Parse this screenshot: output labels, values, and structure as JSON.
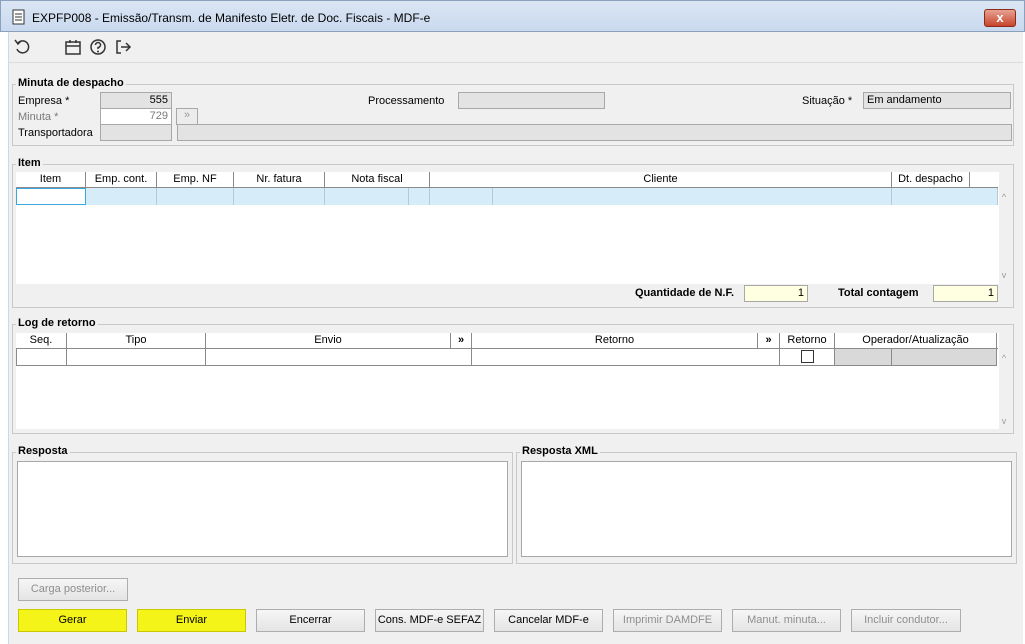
{
  "window": {
    "title": "EXPFP008 - Emissão/Transm. de Manifesto Eletr. de Doc. Fiscais - MDF-e",
    "close_label": "x"
  },
  "toolbar": {
    "icons": [
      "refresh-icon",
      "calendar-icon",
      "help-icon",
      "exit-icon"
    ]
  },
  "minuta": {
    "title": "Minuta de despacho",
    "empresa_label": "Empresa *",
    "empresa_value": "555",
    "minuta_label": "Minuta *",
    "minuta_value": "729",
    "transportadora_label": "Transportadora",
    "processamento_label": "Processamento",
    "situacao_label": "Situação *",
    "situacao_value": "Em andamento"
  },
  "item": {
    "title": "Item",
    "columns": [
      "Item",
      "Emp. cont.",
      "Emp. NF",
      "Nr. fatura",
      "Nota fiscal",
      "Cliente",
      "Dt. despacho"
    ],
    "qtd_nf_label": "Quantidade de N.F.",
    "qtd_nf_value": "1",
    "total_label": "Total contagem",
    "total_value": "1"
  },
  "log": {
    "title": "Log de retorno",
    "columns": [
      "Seq.",
      "Tipo",
      "Envio",
      "»",
      "Retorno",
      "»",
      "Retorno",
      "Operador/Atualização"
    ]
  },
  "resposta": {
    "title": "Resposta"
  },
  "resposta_xml": {
    "title": "Resposta XML"
  },
  "buttons": {
    "carga": "Carga posterior...",
    "gerar": "Gerar",
    "enviar": "Enviar",
    "encerrar": "Encerrar",
    "cons": "Cons. MDF-e SEFAZ",
    "cancelar": "Cancelar MDF-e",
    "imprimir": "Imprimir DAMDFE",
    "manut": "Manut. minuta...",
    "incluir": "Incluir condutor..."
  },
  "colors": {
    "highlight": "#f4f418",
    "selection": "#d6ecf9",
    "readonly": "#e3e3e3",
    "numeric": "#ffffe1"
  }
}
